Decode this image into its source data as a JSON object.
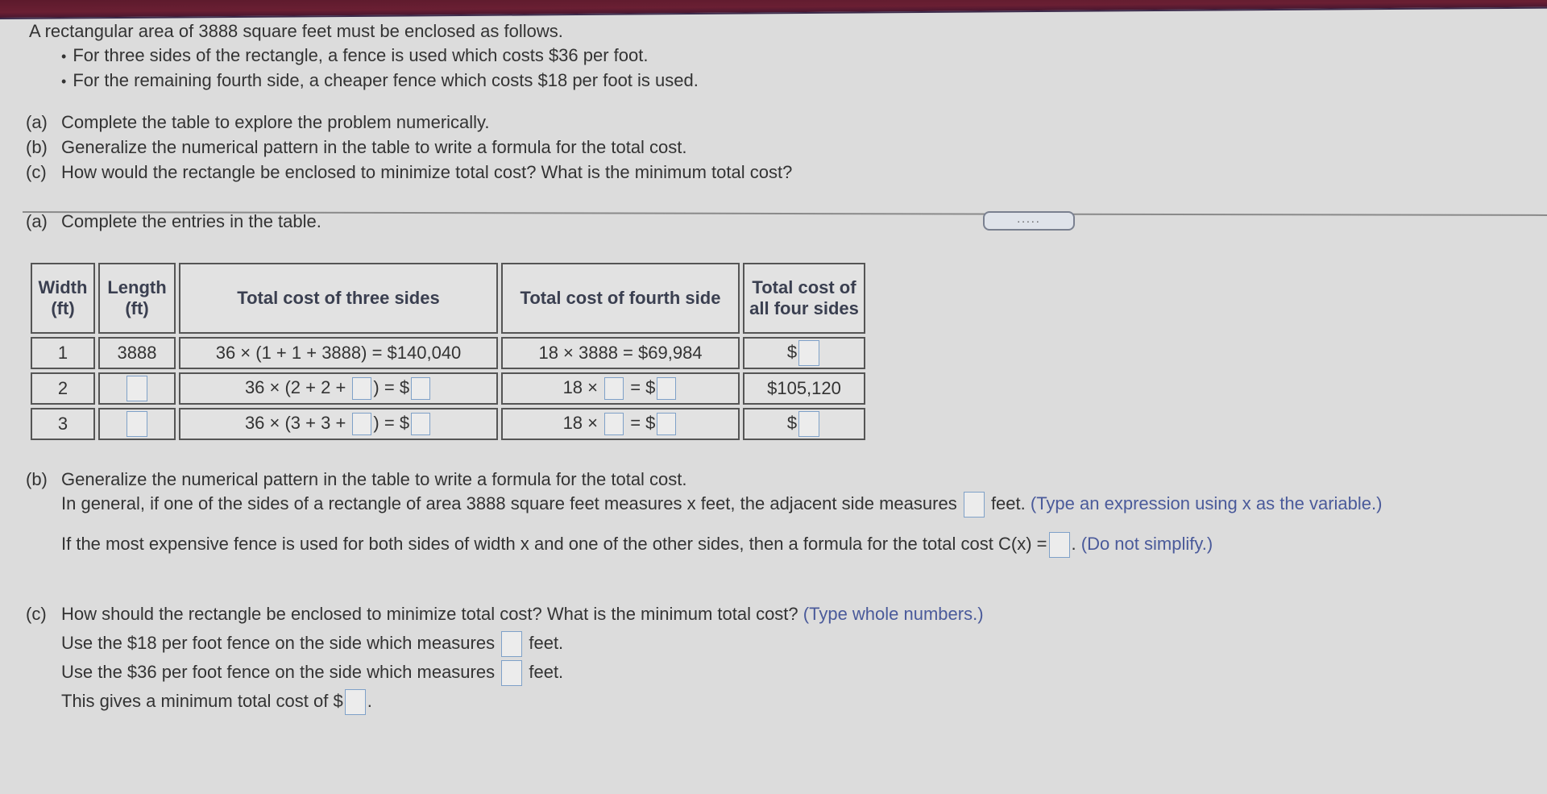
{
  "header_bar": {
    "color": "#631d31"
  },
  "intro": {
    "lead": "A rectangular area of 3888 square feet must be enclosed as follows.",
    "bullets": [
      "For three sides of the rectangle, a fence is used which costs $36 per foot.",
      "For the remaining fourth side, a cheaper fence which costs $18 per foot is used."
    ]
  },
  "parts": [
    {
      "label": "(a)",
      "text": "Complete the table to explore the problem numerically."
    },
    {
      "label": "(b)",
      "text": "Generalize the numerical pattern in the table to write a formula for the total cost."
    },
    {
      "label": "(c)",
      "text": "How would the rectangle be enclosed to minimize total cost? What is the minimum total cost?"
    }
  ],
  "expand_button": {
    "label": "....."
  },
  "section_a": {
    "label": "(a)",
    "text": "Complete the entries in the table.",
    "table": {
      "headers": [
        "Width (ft)",
        "Length (ft)",
        "Total cost of three sides",
        "Total cost of fourth side",
        "Total cost of all four sides"
      ],
      "rows": [
        {
          "width": "1",
          "length": "3888",
          "three_sides": "36 × (1 + 1 + 3888) = $140,040",
          "fourth_side": "18 × 3888 = $69,984",
          "all_four_prefix": "$",
          "all_four_value": ""
        },
        {
          "width": "2",
          "length": "",
          "three_prefix": "36 × (2 + 2 + ",
          "three_mid": ") = $",
          "fourth_prefix": "18 × ",
          "fourth_mid": " = $",
          "all_four": "$105,120"
        },
        {
          "width": "3",
          "length": "",
          "three_prefix": "36 × (3 + 3 + ",
          "three_mid": ") = $",
          "fourth_prefix": "18 × ",
          "fourth_mid": " = $",
          "all_four_prefix": "$",
          "all_four_value": ""
        }
      ]
    }
  },
  "section_b": {
    "label": "(b)",
    "title": "Generalize the numerical pattern in the table to write a formula for the total cost.",
    "line1_before": "In general, if one of the sides of a rectangle of area 3888 square feet measures x feet, the adjacent side measures",
    "line1_after": "feet.",
    "line1_hint": "(Type an expression using x as the variable.)",
    "line2_before": "If the most expensive fence is used for both sides of width x and one of the other sides, then a formula for the total cost C(x) =",
    "line2_after": ".",
    "line2_hint": "(Do not simplify.)"
  },
  "section_c": {
    "label": "(c)",
    "title": "How should the rectangle be enclosed to minimize total cost? What is the minimum total cost?",
    "hint": "(Type whole numbers.)",
    "line1_before": "Use the $18 per foot fence on the side which measures",
    "line1_after": "feet.",
    "line2_before": "Use the $36 per foot fence on the side which measures",
    "line2_after": "feet.",
    "line3_before": "This gives a minimum total cost of $",
    "line3_after": "."
  }
}
